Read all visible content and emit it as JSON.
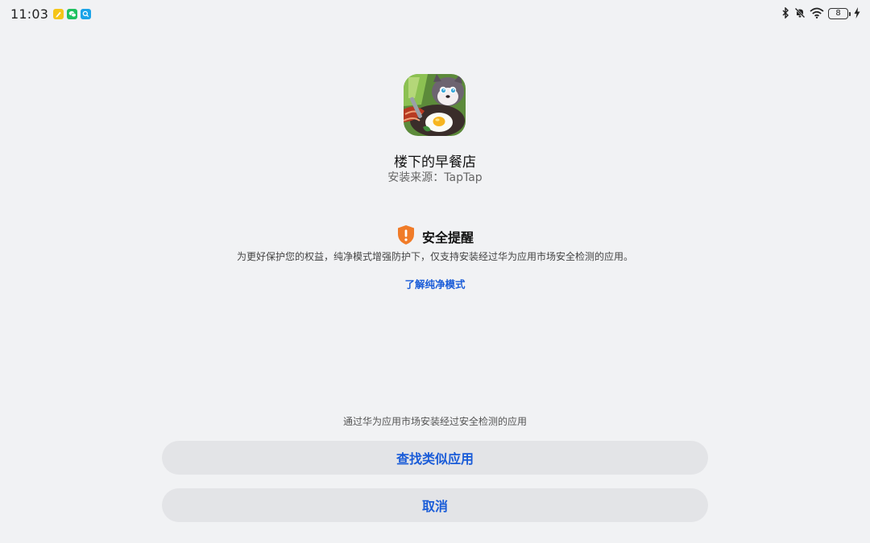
{
  "status_bar": {
    "time": "11:03",
    "battery_level": "8",
    "notification_icons": [
      "notes-app-icon",
      "wechat-icon",
      "search-app-icon"
    ],
    "system_icons": [
      "bluetooth-icon",
      "mute-icon",
      "wifi-icon",
      "battery-icon",
      "charging-icon"
    ]
  },
  "app": {
    "name": "楼下的早餐店",
    "source": "安装来源：TapTap"
  },
  "security": {
    "title": "安全提醒",
    "description": "为更好保护您的权益，纯净模式增强防护下，仅支持安装经过华为应用市场安全检测的应用。",
    "learn_more": "了解纯净模式"
  },
  "bottom": {
    "hint": "通过华为应用市场安装经过安全检测的应用",
    "find_similar_label": "查找类似应用",
    "cancel_label": "取消"
  },
  "colors": {
    "background": "#f1f2f4",
    "accent": "#1a5cd8",
    "warning": "#f07b28",
    "button_bg": "#e3e4e7"
  }
}
